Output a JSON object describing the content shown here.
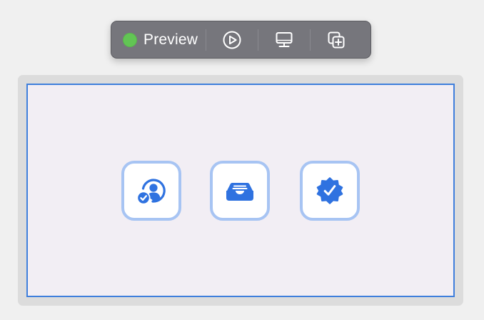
{
  "toolbar": {
    "status_label": "Preview",
    "status_color": "#62c554",
    "buttons": [
      {
        "icon": "play-circle-icon"
      },
      {
        "icon": "display-icon"
      },
      {
        "icon": "duplicate-icon"
      }
    ]
  },
  "canvas": {
    "accent_color": "#3f7fdc",
    "tiles": [
      {
        "icon": "person-checkmark-icon"
      },
      {
        "icon": "tray-icon"
      },
      {
        "icon": "checkmark-seal-icon"
      }
    ]
  }
}
